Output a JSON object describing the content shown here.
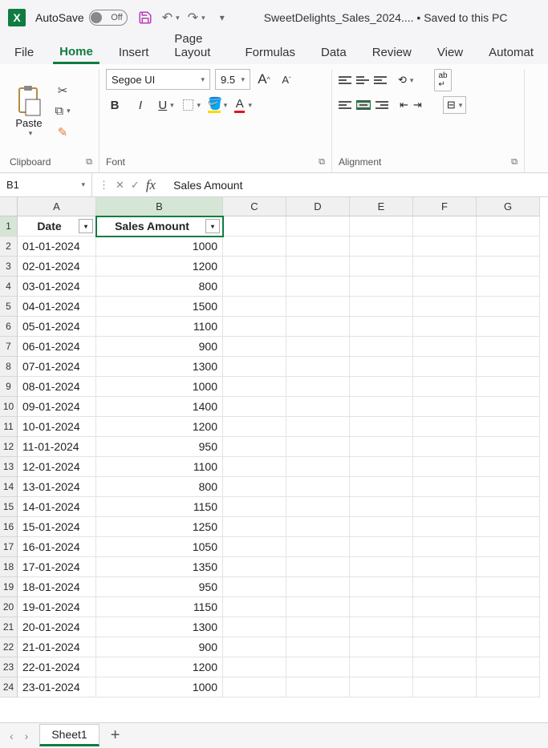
{
  "titlebar": {
    "autosave_label": "AutoSave",
    "autosave_state": "Off",
    "filename": "SweetDelights_Sales_2024....",
    "save_status": "Saved to this PC"
  },
  "tabs": {
    "file": "File",
    "home": "Home",
    "insert": "Insert",
    "page_layout": "Page Layout",
    "formulas": "Formulas",
    "data": "Data",
    "review": "Review",
    "view": "View",
    "automate": "Automat"
  },
  "ribbon": {
    "paste": "Paste",
    "clipboard_label": "Clipboard",
    "font_name": "Segoe UI",
    "font_size": "9.5",
    "font_label": "Font",
    "alignment_label": "Alignment",
    "bold": "B",
    "italic": "I",
    "underline": "U"
  },
  "namebox": "B1",
  "formula_value": "Sales Amount",
  "col_labels": [
    "A",
    "B",
    "C",
    "D",
    "E",
    "F",
    "G"
  ],
  "table": {
    "headers": {
      "date": "Date",
      "sales": "Sales Amount"
    },
    "rows": [
      {
        "n": 2,
        "date": "01-01-2024",
        "sales": "1000"
      },
      {
        "n": 3,
        "date": "02-01-2024",
        "sales": "1200"
      },
      {
        "n": 4,
        "date": "03-01-2024",
        "sales": "800"
      },
      {
        "n": 5,
        "date": "04-01-2024",
        "sales": "1500"
      },
      {
        "n": 6,
        "date": "05-01-2024",
        "sales": "1100"
      },
      {
        "n": 7,
        "date": "06-01-2024",
        "sales": "900"
      },
      {
        "n": 8,
        "date": "07-01-2024",
        "sales": "1300"
      },
      {
        "n": 9,
        "date": "08-01-2024",
        "sales": "1000"
      },
      {
        "n": 10,
        "date": "09-01-2024",
        "sales": "1400"
      },
      {
        "n": 11,
        "date": "10-01-2024",
        "sales": "1200"
      },
      {
        "n": 12,
        "date": "11-01-2024",
        "sales": "950"
      },
      {
        "n": 13,
        "date": "12-01-2024",
        "sales": "1100"
      },
      {
        "n": 14,
        "date": "13-01-2024",
        "sales": "800"
      },
      {
        "n": 15,
        "date": "14-01-2024",
        "sales": "1150"
      },
      {
        "n": 16,
        "date": "15-01-2024",
        "sales": "1250"
      },
      {
        "n": 17,
        "date": "16-01-2024",
        "sales": "1050"
      },
      {
        "n": 18,
        "date": "17-01-2024",
        "sales": "1350"
      },
      {
        "n": 19,
        "date": "18-01-2024",
        "sales": "950"
      },
      {
        "n": 20,
        "date": "19-01-2024",
        "sales": "1150"
      },
      {
        "n": 21,
        "date": "20-01-2024",
        "sales": "1300"
      },
      {
        "n": 22,
        "date": "21-01-2024",
        "sales": "900"
      },
      {
        "n": 23,
        "date": "22-01-2024",
        "sales": "1200"
      },
      {
        "n": 24,
        "date": "23-01-2024",
        "sales": "1000"
      }
    ]
  },
  "sheets": {
    "sheet1": "Sheet1"
  }
}
